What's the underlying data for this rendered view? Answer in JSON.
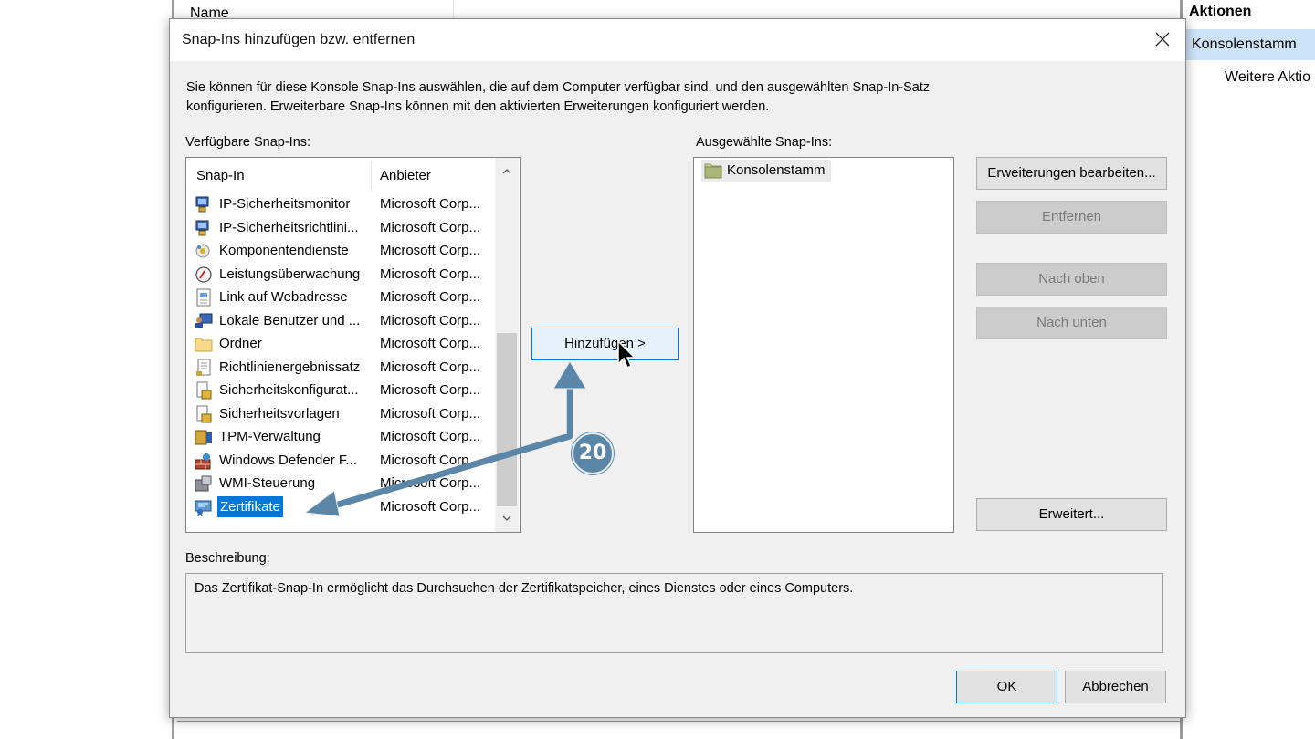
{
  "background": {
    "name_column": "Name",
    "actions_title": "Aktionen",
    "actions_selected": "Konsolenstamm",
    "actions_more": "Weitere Aktio"
  },
  "dialog": {
    "title": "Snap-Ins hinzufügen bzw. entfernen",
    "intro_line1": "Sie können für diese Konsole Snap-Ins auswählen, die auf dem Computer verfügbar sind, und den ausgewählten Snap-In-Satz",
    "intro_line2": "konfigurieren. Erweiterbare Snap-Ins können mit den aktivierten Erweiterungen konfiguriert werden.",
    "available_label": "Verfügbare Snap-Ins:",
    "selected_label": "Ausgewählte Snap-Ins:",
    "columns": {
      "snapin": "Snap-In",
      "vendor": "Anbieter"
    },
    "available": [
      {
        "name": "IP-Sicherheitsmonitor",
        "vendor": "Microsoft Corp...",
        "icon": "ip-security-icon"
      },
      {
        "name": "IP-Sicherheitsrichtlini...",
        "vendor": "Microsoft Corp...",
        "icon": "ip-policy-icon"
      },
      {
        "name": "Komponentendienste",
        "vendor": "Microsoft Corp...",
        "icon": "component-services-icon"
      },
      {
        "name": "Leistungsüberwachung",
        "vendor": "Microsoft Corp...",
        "icon": "performance-monitor-icon"
      },
      {
        "name": "Link auf Webadresse",
        "vendor": "Microsoft Corp...",
        "icon": "web-link-icon"
      },
      {
        "name": "Lokale Benutzer und ...",
        "vendor": "Microsoft Corp...",
        "icon": "local-users-icon"
      },
      {
        "name": "Ordner",
        "vendor": "Microsoft Corp...",
        "icon": "folder-icon"
      },
      {
        "name": "Richtlinienergebnissatz",
        "vendor": "Microsoft Corp...",
        "icon": "policy-result-icon"
      },
      {
        "name": "Sicherheitskonfigurat...",
        "vendor": "Microsoft Corp...",
        "icon": "security-config-icon"
      },
      {
        "name": "Sicherheitsvorlagen",
        "vendor": "Microsoft Corp...",
        "icon": "security-templates-icon"
      },
      {
        "name": "TPM-Verwaltung",
        "vendor": "Microsoft Corp...",
        "icon": "tpm-icon"
      },
      {
        "name": "Windows Defender F...",
        "vendor": "Microsoft Corp...",
        "icon": "firewall-icon"
      },
      {
        "name": "WMI-Steuerung",
        "vendor": "Microsoft Corp...",
        "icon": "wmi-icon"
      },
      {
        "name": "Zertifikate",
        "vendor": "Microsoft Corp...",
        "icon": "certificates-icon",
        "selected": true
      }
    ],
    "selected": [
      {
        "name": "Konsolenstamm",
        "icon": "console-root-folder-icon"
      }
    ],
    "buttons": {
      "add": "Hinzufügen >",
      "edit_extensions": "Erweiterungen bearbeiten...",
      "remove": "Entfernen",
      "move_up": "Nach oben",
      "move_down": "Nach unten",
      "advanced": "Erweitert...",
      "ok": "OK",
      "cancel": "Abbrechen"
    },
    "description_label": "Beschreibung:",
    "description": "Das Zertifikat-Snap-In ermöglicht das Durchsuchen der Zertifikatspeicher, eines Dienstes oder eines Computers."
  },
  "annotation": {
    "step": "20",
    "color": "#5b86a8"
  },
  "colors": {
    "selection": "#0078d7",
    "dialog_bg": "#f0f0f0",
    "actions_highlight": "#cde3f7"
  }
}
